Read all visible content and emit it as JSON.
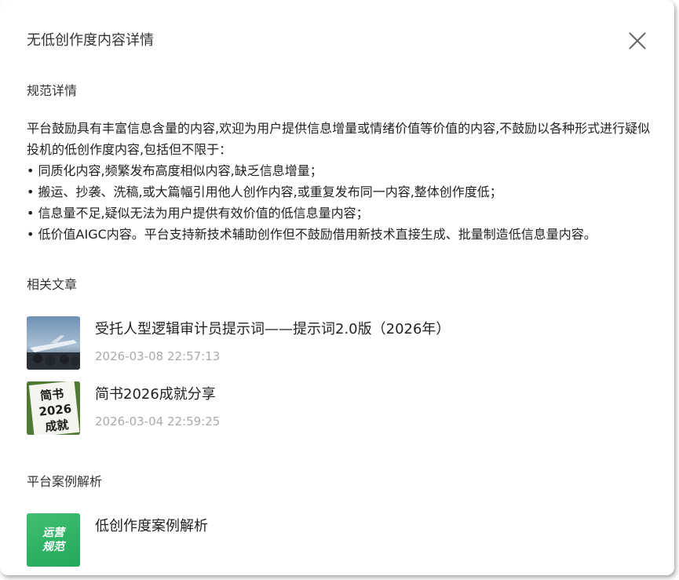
{
  "dialog": {
    "title": "无低创作度内容详情"
  },
  "rules": {
    "heading": "规范详情",
    "intro": "平台鼓励具有丰富信息含量的内容,欢迎为用户提供信息增量或情绪价值等价值的内容,不鼓励以各种形式进行疑似投机的低创作度内容,包括但不限于：",
    "bullets": [
      "• 同质化内容,频繁发布高度相似内容,缺乏信息增量；",
      "• 搬运、抄袭、洗稿,或大篇幅引用他人创作内容,或重复发布同一内容,整体创作度低；",
      "• 信息量不足,疑似无法为用户提供有效价值的低信息量内容；",
      "• 低价值AIGC内容。平台支持新技术辅助创作但不鼓励借用新技术直接生成、批量制造低信息量内容。"
    ]
  },
  "related": {
    "heading": "相关文章",
    "articles": [
      {
        "title": "受托人型逻辑审计员提示词——提示词2.0版（2026年）",
        "date": "2026-03-08 22:57:13",
        "thumb_icon": "airport-photo-icon"
      },
      {
        "title": "简书2026成就分享",
        "date": "2026-03-04 22:59:25",
        "thumb_icon": "paper-sign-icon",
        "thumb_text": [
          "简书",
          "2026",
          "成就"
        ]
      }
    ]
  },
  "cases": {
    "heading": "平台案例解析",
    "articles": [
      {
        "title": "低创作度案例解析",
        "thumb_icon": "ops-rules-badge-icon",
        "thumb_text": [
          "运营",
          "规范"
        ],
        "thumb_color": "#2fb466"
      }
    ]
  }
}
